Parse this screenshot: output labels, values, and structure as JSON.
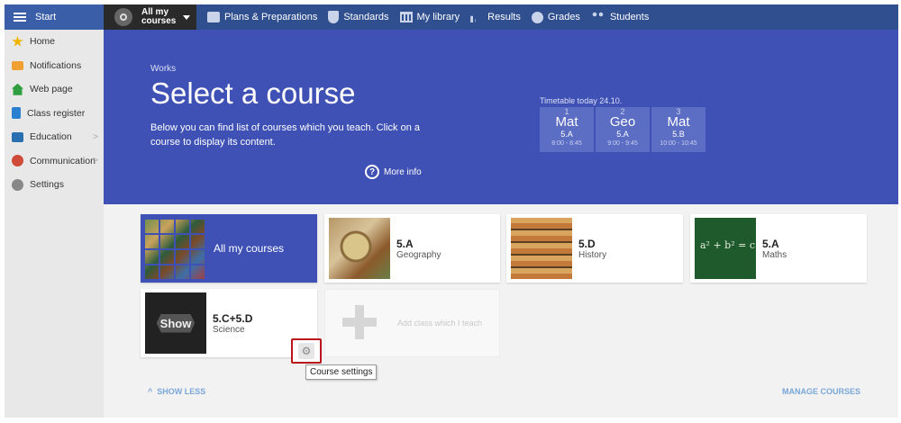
{
  "topbar": {
    "start_label": "Start",
    "current_course_line1": "All my",
    "current_course_line2": "courses",
    "nav": [
      {
        "label": "Plans & Preparations",
        "icon": "plans-icon"
      },
      {
        "label": "Standards",
        "icon": "shield-icon"
      },
      {
        "label": "My library",
        "icon": "library-icon"
      },
      {
        "label": "Results",
        "icon": "bar-chart-icon"
      },
      {
        "label": "Grades",
        "icon": "grades-icon"
      },
      {
        "label": "Students",
        "icon": "students-icon"
      }
    ]
  },
  "sidebar": {
    "items": [
      {
        "label": "Home",
        "icon": "star-icon",
        "color": "#f0b400"
      },
      {
        "label": "Notifications",
        "icon": "envelope-icon",
        "color": "#f0a030"
      },
      {
        "label": "Web page",
        "icon": "house-icon",
        "color": "#2e9e3e"
      },
      {
        "label": "Class register",
        "icon": "book-icon",
        "color": "#2a7fd0"
      },
      {
        "label": "Education",
        "icon": "briefcase-icon",
        "color": "#2a6fb0",
        "chevron": ">"
      },
      {
        "label": "Communication",
        "icon": "chat-icon",
        "color": "#d04a3a",
        "chevron": ">"
      },
      {
        "label": "Settings",
        "icon": "gear-icon",
        "color": "#888888"
      }
    ]
  },
  "hero": {
    "section": "Works",
    "title": "Select a course",
    "description": "Below you can find list of courses which you teach. Click on a course to display its content.",
    "more_info": "More info",
    "timetable_label": "Timetable today 24.10.",
    "timetable": [
      {
        "num": "1",
        "subject": "Mat",
        "class": "5.A",
        "time": "8:00 - 8:45"
      },
      {
        "num": "2",
        "subject": "Geo",
        "class": "5.A",
        "time": "9:00 - 9:45"
      },
      {
        "num": "3",
        "subject": "Mat",
        "class": "5.B",
        "time": "10:00 - 10:45"
      }
    ]
  },
  "courses": {
    "all_label": "All my courses",
    "cards": [
      {
        "code": "5.A",
        "subject": "Geography"
      },
      {
        "code": "5.D",
        "subject": "History"
      },
      {
        "code": "5.A",
        "subject": "Maths"
      },
      {
        "code": "5.C+5.D",
        "subject": "Science",
        "thumb_label": "Show"
      }
    ],
    "math_thumb_text": "a² + b² = c",
    "add_label": "Add class which I teach",
    "settings_tooltip": "Course settings",
    "show_less": "SHOW LESS",
    "manage": "MANAGE COURSES",
    "show_less_chevron": "^"
  },
  "colors": {
    "accent": "#3f51b5",
    "topbar": "#2d2d2d",
    "highlight": "#b8161b"
  }
}
